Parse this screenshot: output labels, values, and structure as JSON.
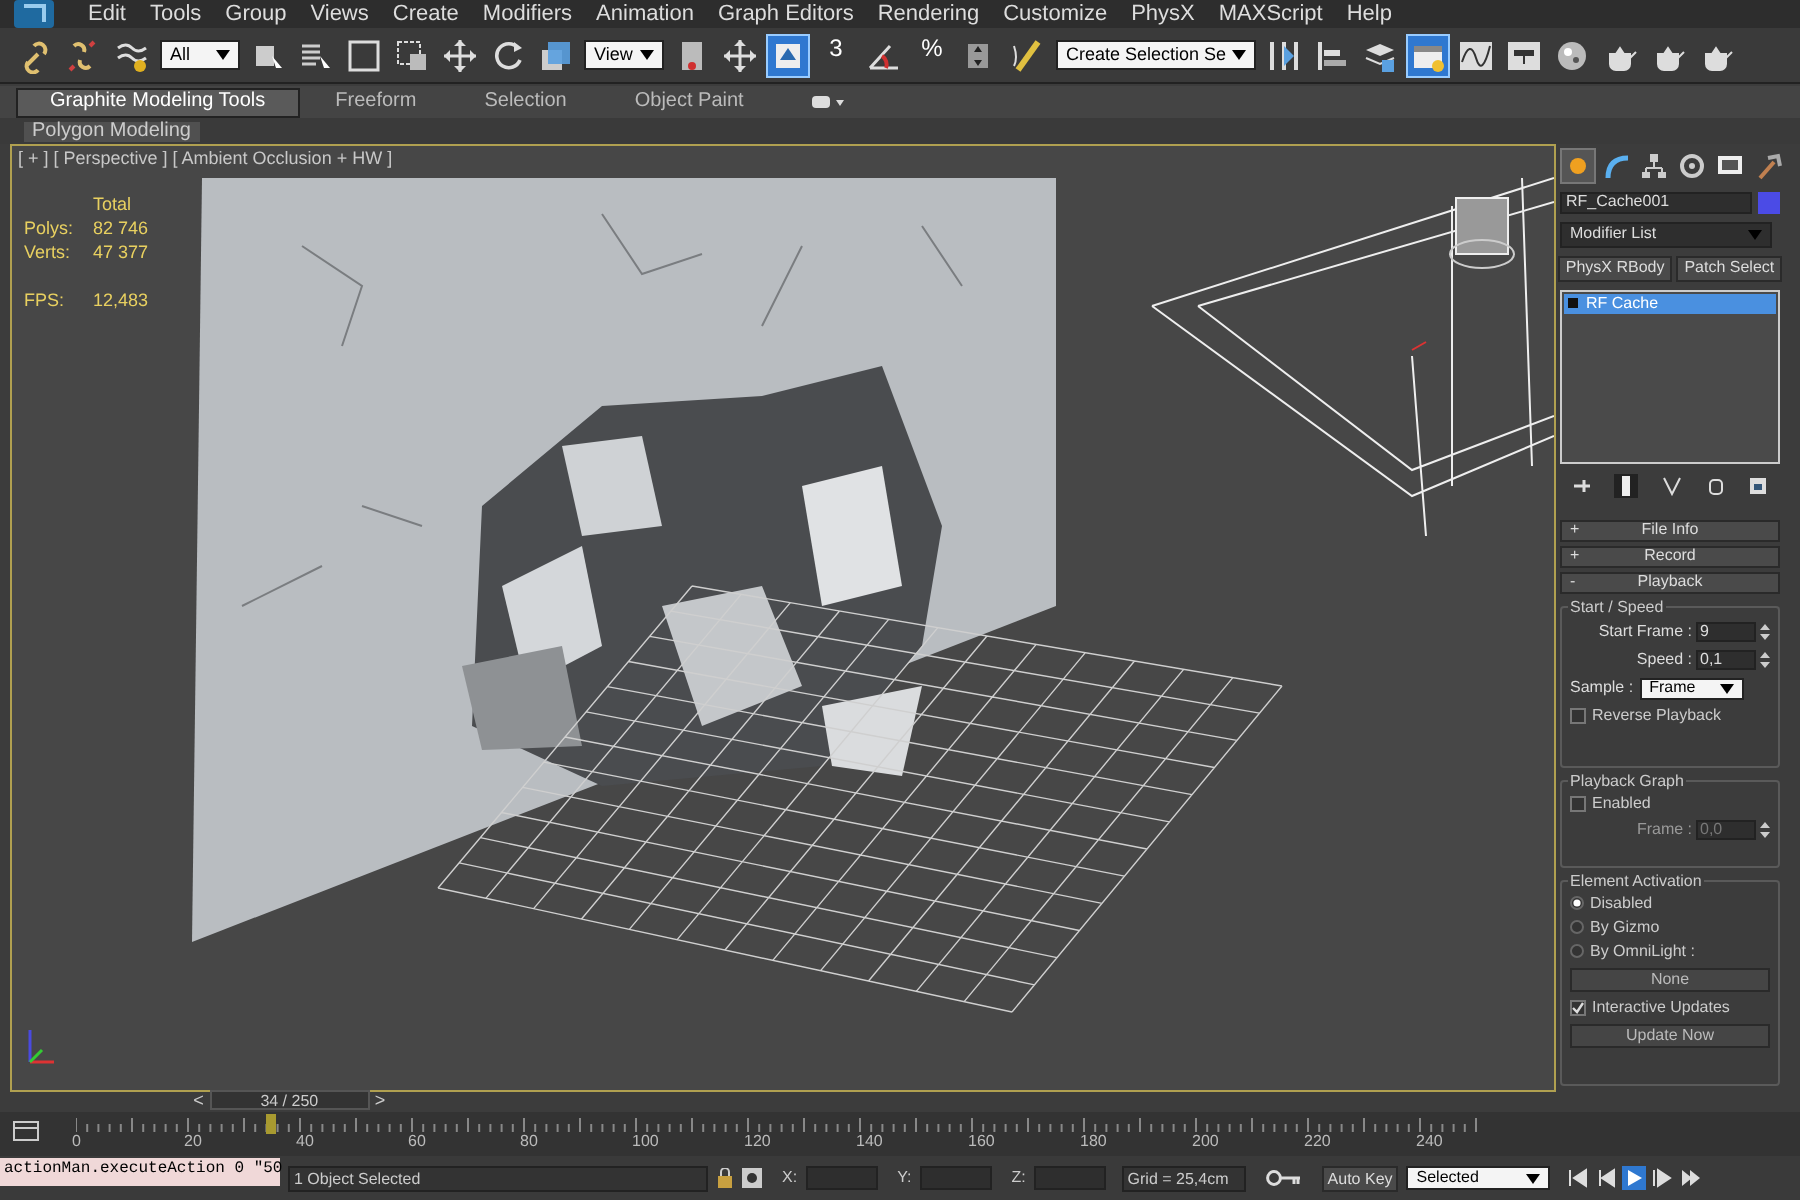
{
  "menu": [
    "Edit",
    "Tools",
    "Group",
    "Views",
    "Create",
    "Modifiers",
    "Animation",
    "Graph Editors",
    "Rendering",
    "Customize",
    "PhysX",
    "MAXScript",
    "Help"
  ],
  "toolbar": [
    {
      "kind": "icon",
      "active": false
    },
    {
      "kind": "icon",
      "active": false
    },
    {
      "kind": "icon",
      "active": false
    },
    {
      "kind": "dropdown",
      "value": "All"
    },
    {
      "kind": "icon",
      "active": false
    },
    {
      "kind": "icon",
      "active": false
    },
    {
      "kind": "icon",
      "active": false
    },
    {
      "kind": "icon",
      "active": false
    },
    {
      "kind": "icon",
      "active": false
    },
    {
      "kind": "icon",
      "active": false
    },
    {
      "kind": "icon",
      "active": false
    },
    {
      "kind": "dropdown",
      "value": "View"
    },
    {
      "kind": "icon",
      "active": false
    },
    {
      "kind": "icon",
      "active": false
    },
    {
      "kind": "icon",
      "active": true
    },
    {
      "kind": "snap",
      "text": "3"
    },
    {
      "kind": "icon",
      "active": false
    },
    {
      "kind": "snap",
      "text": "%"
    },
    {
      "kind": "icon",
      "active": false
    },
    {
      "kind": "icon",
      "active": false
    },
    {
      "kind": "dropdown",
      "value": "Create Selection Se"
    },
    {
      "kind": "icon",
      "active": false
    },
    {
      "kind": "icon",
      "active": false
    },
    {
      "kind": "icon",
      "active": false
    },
    {
      "kind": "icon",
      "active": true
    },
    {
      "kind": "icon",
      "active": false
    },
    {
      "kind": "icon",
      "active": false
    },
    {
      "kind": "icon",
      "active": false
    },
    {
      "kind": "icon",
      "active": false
    },
    {
      "kind": "icon",
      "active": false
    },
    {
      "kind": "icon",
      "active": false
    }
  ],
  "ribbon_tabs": [
    {
      "label": "Graphite Modeling Tools",
      "selected": true
    },
    {
      "label": "Freeform",
      "selected": false
    },
    {
      "label": "Selection",
      "selected": false
    },
    {
      "label": "Object Paint",
      "selected": false
    }
  ],
  "ribbon_panel": "Polygon Modeling",
  "viewport": {
    "label": "[ + ] [ Perspective ] [ Ambient Occlusion + HW ]",
    "stats_header": "Total",
    "stats": [
      {
        "label": "Polys:",
        "value": "82 746"
      },
      {
        "label": "Verts:",
        "value": "47 377"
      },
      {
        "label": "FPS:",
        "value": "12,483"
      }
    ]
  },
  "command_panel": {
    "tabs": [
      {
        "selected": true
      },
      {
        "selected": false
      },
      {
        "selected": false
      },
      {
        "selected": false
      },
      {
        "selected": false
      },
      {
        "selected": false
      }
    ],
    "object_name": "RF_Cache001",
    "modifier_list": "Modifier List",
    "buttons": [
      "PhysX RBody",
      "Patch Select"
    ],
    "stack": [
      {
        "label": "RF Cache",
        "selected": true
      }
    ],
    "rollouts": [
      {
        "sign": "+",
        "title": "File Info"
      },
      {
        "sign": "+",
        "title": "Record"
      },
      {
        "sign": "-",
        "title": "Playback"
      }
    ],
    "start_speed": {
      "title": "Start / Speed",
      "start_frame": {
        "label": "Start Frame :",
        "value": "9"
      },
      "speed": {
        "label": "Speed :",
        "value": "0,1"
      },
      "sample": {
        "label": "Sample :",
        "value": "Frame"
      },
      "reverse": {
        "label": "Reverse Playback",
        "checked": false
      }
    },
    "playback_graph": {
      "title": "Playback Graph",
      "enabled": {
        "label": "Enabled",
        "checked": false
      },
      "frame": {
        "label": "Frame :",
        "value": "0,0",
        "disabled": true
      }
    },
    "element_activation": {
      "title": "Element Activation",
      "options": [
        {
          "label": "Disabled",
          "selected": true
        },
        {
          "label": "By Gizmo",
          "selected": false
        },
        {
          "label": "By OmniLight :",
          "selected": false
        }
      ],
      "none_button": "None",
      "interactive": {
        "label": "Interactive Updates",
        "checked": true
      },
      "update_button": "Update Now"
    }
  },
  "time_slider": {
    "prev": "<",
    "position": "34 / 250",
    "next": ">",
    "level": 0.136
  },
  "ruler": [
    "0",
    "20",
    "40",
    "60",
    "80",
    "100",
    "120",
    "140",
    "160",
    "180",
    "200",
    "220",
    "240"
  ],
  "status": {
    "listener": "actionMan.executeAction 0 \"50",
    "selection": "1 Object Selected",
    "x": "X:",
    "y": "Y:",
    "z": "Z:",
    "grid": "Grid = 25,4cm",
    "auto_key": "Auto Key",
    "key_mode": "Selected"
  }
}
